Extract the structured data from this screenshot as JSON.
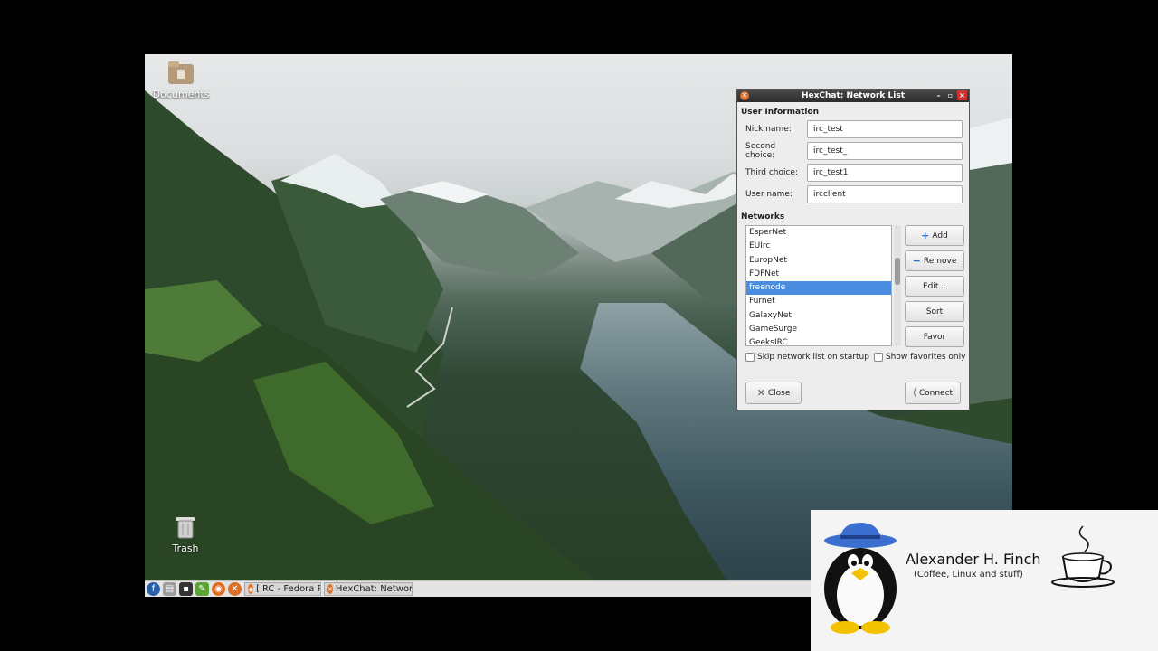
{
  "desktop": {
    "icons": [
      {
        "label": "Documents"
      },
      {
        "label": "Trash"
      }
    ]
  },
  "taskbar": {
    "tasks": [
      {
        "label": "[IRC - Fedora Proj..."
      },
      {
        "label": "HexChat: Networ..."
      }
    ]
  },
  "hexchat": {
    "title": "HexChat: Network List",
    "user_info_title": "User Information",
    "fields": [
      {
        "label": "Nick name:",
        "value": "irc_test"
      },
      {
        "label": "Second choice:",
        "value": "irc_test_"
      },
      {
        "label": "Third choice:",
        "value": "irc_test1"
      },
      {
        "label": "User name:",
        "value": "ircclient"
      }
    ],
    "networks_title": "Networks",
    "networks": [
      "EsperNet",
      "EUIrc",
      "EuropNet",
      "FDFNet",
      "freenode",
      "Furnet",
      "GalaxyNet",
      "GameSurge",
      "GeeksIRC"
    ],
    "selected_network": "freenode",
    "buttons": {
      "add": "Add",
      "remove": "Remove",
      "edit": "Edit...",
      "sort": "Sort",
      "favor": "Favor"
    },
    "checkboxes": {
      "skip": "Skip network list on startup",
      "favorites": "Show favorites only"
    },
    "close": "Close",
    "connect": "Connect"
  },
  "overlay": {
    "name": "Alexander H. Finch",
    "subtitle": "(Coffee, Linux and stuff)"
  },
  "colors": {
    "selection": "#4a8de0",
    "titlebar": "#2c2c2c"
  }
}
